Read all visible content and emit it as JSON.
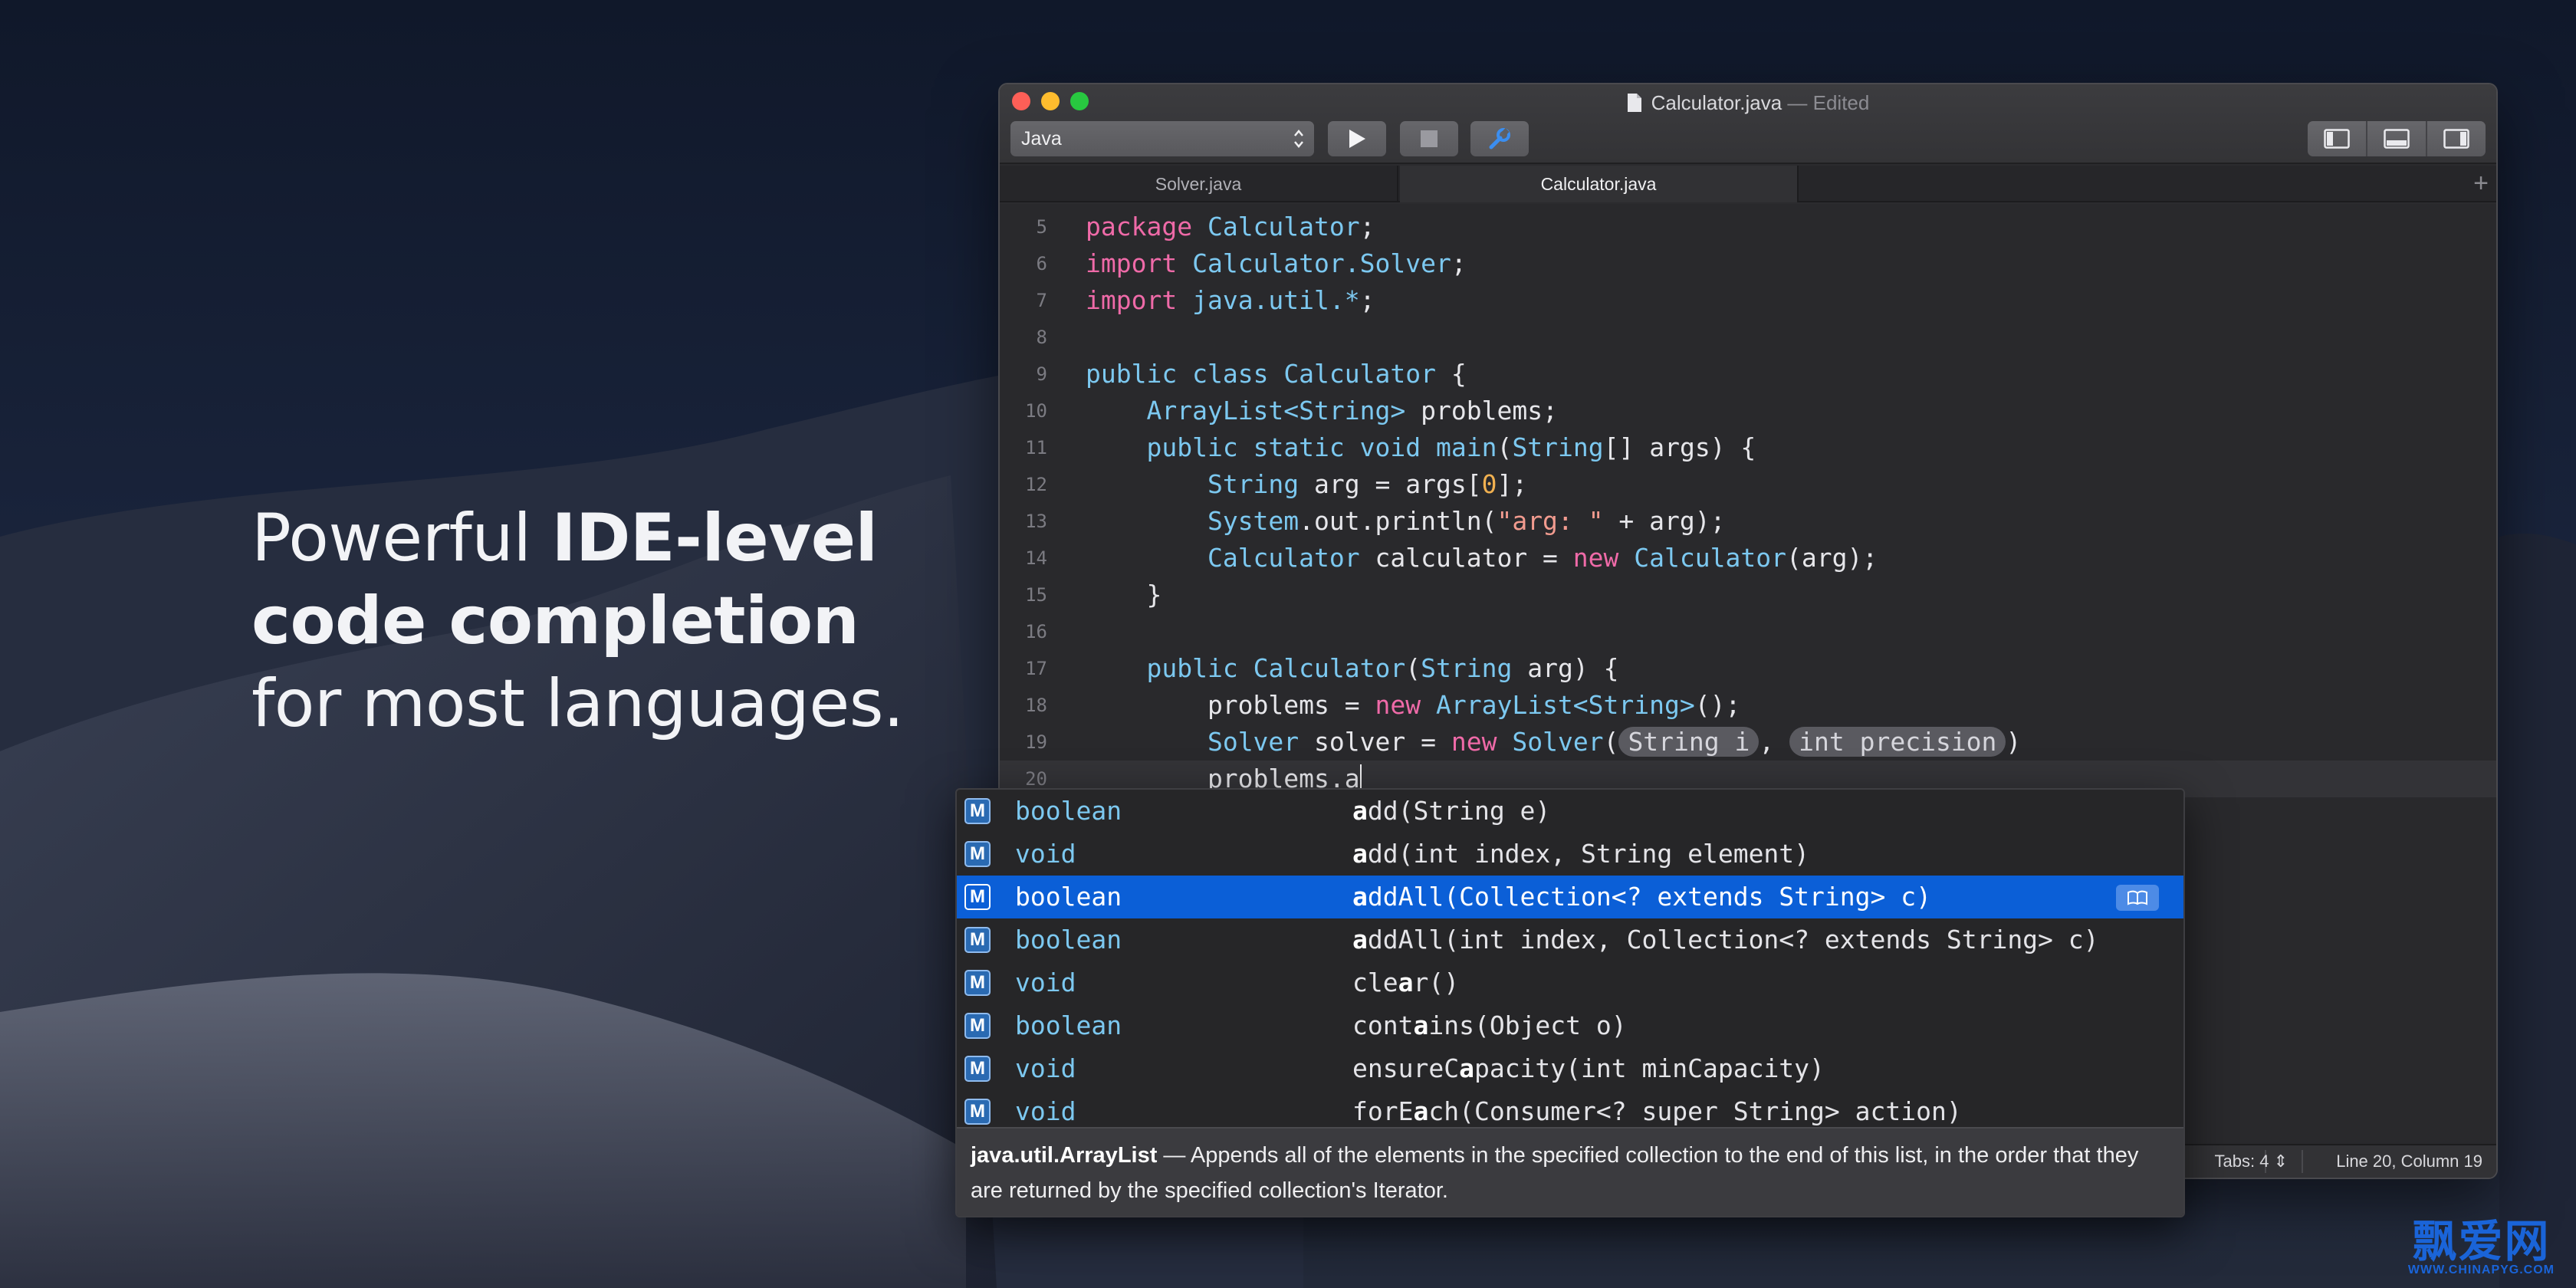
{
  "headline": {
    "line1_pre": "Powerful ",
    "line1_bold": "IDE-level",
    "line2_bold": "code completion",
    "line3": "for most languages."
  },
  "window": {
    "title": "Calculator.java",
    "title_suffix": " — Edited",
    "syntax": "Java",
    "toolbar": {
      "run_icon": "play-icon",
      "stop_icon": "stop-icon",
      "build_icon": "wrench-icon"
    },
    "tabs": [
      {
        "label": "Solver.java",
        "active": false
      },
      {
        "label": "Calculator.java",
        "active": true
      }
    ],
    "line_numbers": [
      "5",
      "6",
      "7",
      "8",
      "9",
      "10",
      "11",
      "12",
      "13",
      "14",
      "15",
      "16",
      "17",
      "18",
      "19",
      "20"
    ],
    "status": {
      "tabs": "Tabs: 4",
      "position": "Line 20, Column 19"
    }
  },
  "completion": {
    "items": [
      {
        "type": "boolean",
        "sig_parts": [
          "",
          "a",
          "dd(String e)"
        ]
      },
      {
        "type": "void",
        "sig_parts": [
          "",
          "a",
          "dd(int index, String element)"
        ]
      },
      {
        "type": "boolean",
        "sig_parts": [
          "",
          "a",
          "ddAll(Collection<? extends String> c)"
        ],
        "selected": true
      },
      {
        "type": "boolean",
        "sig_parts": [
          "",
          "a",
          "ddAll(int index, Collection<? extends String> c)"
        ]
      },
      {
        "type": "void",
        "sig_parts": [
          "cle",
          "a",
          "r()"
        ]
      },
      {
        "type": "boolean",
        "sig_parts": [
          "cont",
          "a",
          "ins(Object o)"
        ]
      },
      {
        "type": "void",
        "sig_parts": [
          "ensureC",
          "a",
          "pacity(int minCapacity)"
        ]
      },
      {
        "type": "void",
        "sig_parts": [
          "forE",
          "a",
          "ch(Consumer<? super String> action)"
        ]
      }
    ],
    "badge": "M",
    "doc_class": "java.util.ArrayList",
    "doc_text": " — Appends all of the elements in the specified collection to the end of this list, in the order that they are returned by the specified collection's Iterator."
  },
  "watermark": {
    "logo": "飘爱网",
    "url": "WWW.CHINAPYG.COM"
  },
  "colors": {
    "accent": "#0b5fd7",
    "keyword": "#ef6aa8",
    "type": "#7cc8f0",
    "string": "#f29b8f"
  }
}
